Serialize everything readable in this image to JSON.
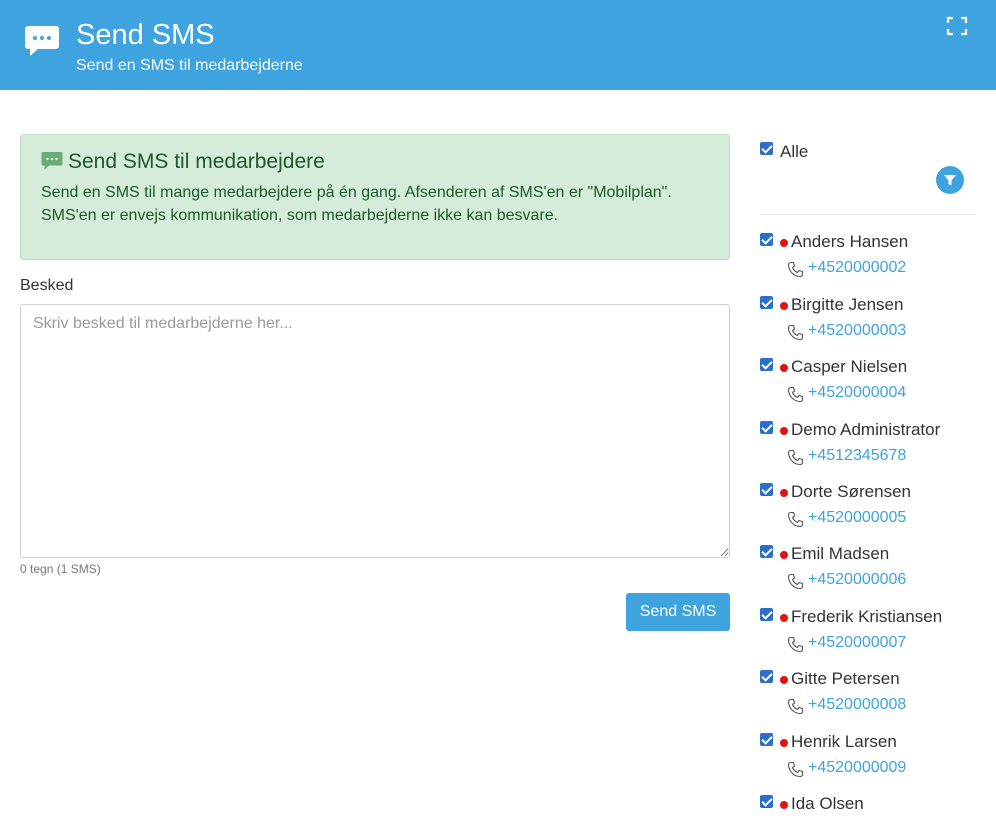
{
  "header": {
    "title": "Send SMS",
    "subtitle": "Send en SMS til medarbejderne",
    "icon": "sms-icon",
    "expand_icon": "expand-icon"
  },
  "info": {
    "title": "Send SMS til medarbejdere",
    "line1": "Send en SMS til mange medarbejdere på én gang. Afsenderen af SMS'en er \"Mobilplan\".",
    "line2": "SMS'en er envejs kommunikation, som medarbejderne ikke kan besvare."
  },
  "form": {
    "label": "Besked",
    "placeholder": "Skriv besked til medarbejderne her...",
    "value": "",
    "char_count": "0 tegn (1 SMS)",
    "send_label": "Send SMS"
  },
  "recipients": {
    "all_label": "Alle",
    "all_checked": true,
    "status_color": "#e01313",
    "link_color": "#3fa3e0",
    "members": [
      {
        "name": "Anders Hansen",
        "phone": "+4520000002"
      },
      {
        "name": "Birgitte Jensen",
        "phone": "+4520000003"
      },
      {
        "name": "Casper Nielsen",
        "phone": "+4520000004"
      },
      {
        "name": "Demo Administrator",
        "phone": "+4512345678"
      },
      {
        "name": "Dorte Sørensen",
        "phone": "+4520000005"
      },
      {
        "name": "Emil Madsen",
        "phone": "+4520000006"
      },
      {
        "name": "Frederik Kristiansen",
        "phone": "+4520000007"
      },
      {
        "name": "Gitte Petersen",
        "phone": "+4520000008"
      },
      {
        "name": "Henrik Larsen",
        "phone": "+4520000009"
      },
      {
        "name": "Ida Olsen",
        "phone": ""
      }
    ]
  },
  "colors": {
    "accent": "#3fa3e0",
    "success_bg": "#d4ecd9",
    "success_text": "#1e5a28"
  }
}
